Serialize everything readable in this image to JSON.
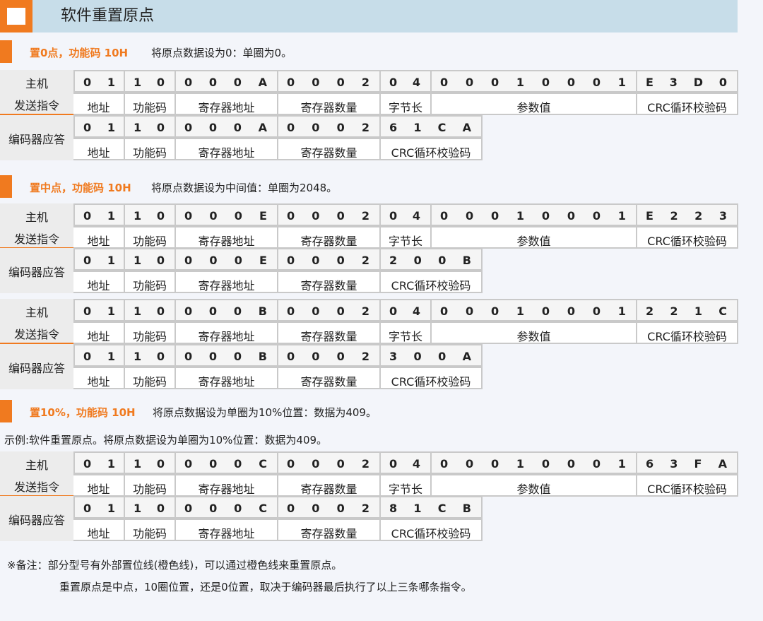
{
  "title": "软件重置原点",
  "sections": [
    {
      "lead": "置0点，功能码 10H",
      "desc": "将原点数据设为0：单圈为0。"
    },
    {
      "lead": "置中点，功能码 10H",
      "desc": "将原点数据设为中间值：单圈为2048。"
    },
    {
      "lead": "置10%，功能码 10H",
      "desc": "将原点数据设为单圈为10%位置：数据为409。"
    }
  ],
  "example": "示例:软件重置原点。将原点数据设为单圈为10%位置：数据为409。",
  "labels": {
    "host": "主机",
    "send": "发送指令",
    "reply": "编码器应答",
    "addr": "地址",
    "func": "功能码",
    "reg_addr": "寄存器地址",
    "reg_count": "寄存器数量",
    "byte_len": "字节长",
    "param": "参数值",
    "crc": "CRC循环校验码"
  },
  "frames": [
    {
      "send": {
        "addr": "01",
        "func": "10",
        "reg": "000A",
        "cnt": "0002",
        "len": "04",
        "param": "00010001",
        "crc": "E3D0"
      },
      "reply": {
        "addr": "01",
        "func": "10",
        "reg": "000A",
        "cnt": "0002",
        "crc": "61CA"
      }
    },
    {
      "send": {
        "addr": "01",
        "func": "10",
        "reg": "000E",
        "cnt": "0002",
        "len": "04",
        "param": "00010001",
        "crc": "E223"
      },
      "reply": {
        "addr": "01",
        "func": "10",
        "reg": "000E",
        "cnt": "0002",
        "crc": "200B"
      }
    },
    {
      "send": {
        "addr": "01",
        "func": "10",
        "reg": "000B",
        "cnt": "0002",
        "len": "04",
        "param": "00010001",
        "crc": "221C"
      },
      "reply": {
        "addr": "01",
        "func": "10",
        "reg": "000B",
        "cnt": "0002",
        "crc": "300A"
      }
    },
    {
      "send": {
        "addr": "01",
        "func": "10",
        "reg": "000C",
        "cnt": "0002",
        "len": "04",
        "param": "00010001",
        "crc": "63FA"
      },
      "reply": {
        "addr": "01",
        "func": "10",
        "reg": "000C",
        "cnt": "0002",
        "crc": "81CB"
      }
    }
  ],
  "notes": [
    "※备注：部分型号有外部置位线(橙色线)，可以通过橙色线来重置原点。",
    "重置原点是中点，10圈位置，还是0位置，取决于编码器最后执行了以上三条哪条指令。"
  ]
}
